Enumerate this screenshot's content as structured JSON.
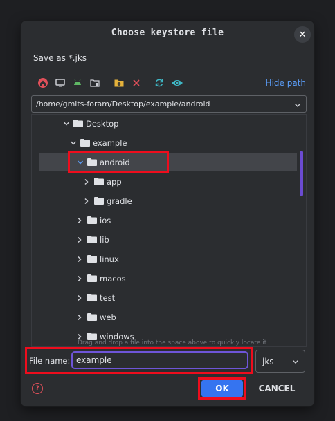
{
  "dialog": {
    "title": "Choose keystore file",
    "close_icon": "close-icon",
    "subtitle": "Save as *.jks"
  },
  "toolbar": {
    "icons": [
      "home-icon",
      "desktop-icon",
      "android-icon",
      "module-icon",
      "new-folder-icon",
      "delete-icon",
      "refresh-icon",
      "show-hidden-icon"
    ],
    "hide_path": "Hide path"
  },
  "path": {
    "value": "/home/gmits-foram/Desktop/example/android"
  },
  "tree": {
    "rows": [
      {
        "label": "Desktop",
        "expanded": true
      },
      {
        "label": "example",
        "expanded": true
      },
      {
        "label": "android",
        "expanded": true,
        "selected": true
      },
      {
        "label": "app",
        "expanded": false
      },
      {
        "label": "gradle",
        "expanded": false
      },
      {
        "label": "ios",
        "expanded": false
      },
      {
        "label": "lib",
        "expanded": false
      },
      {
        "label": "linux",
        "expanded": false
      },
      {
        "label": "macos",
        "expanded": false
      },
      {
        "label": "test",
        "expanded": false
      },
      {
        "label": "web",
        "expanded": false
      },
      {
        "label": "windows",
        "expanded": false
      }
    ],
    "drag_hint": "Drag and drop a file into the space above to quickly locate it"
  },
  "file_name": {
    "label": "File name:",
    "value": "example"
  },
  "extension": {
    "selected": "jks"
  },
  "buttons": {
    "help_icon": "help-icon",
    "ok": "OK",
    "cancel": "CANCEL"
  },
  "colors": {
    "accent": "#3574f0",
    "highlight": "#ee0d1d",
    "focus": "#6e55d8"
  }
}
